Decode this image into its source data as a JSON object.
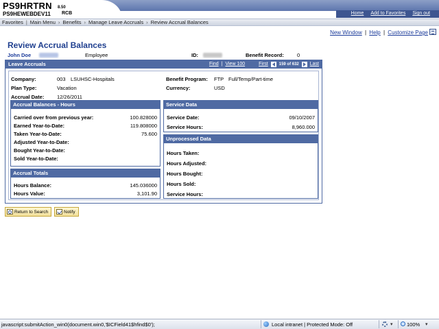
{
  "header": {
    "app_name": "PS9HRTRN",
    "version": "8.50",
    "database": "PS9HEWEBDEV11",
    "user": "RCB",
    "links": [
      "Home",
      "Add to Favorites",
      "Sign out"
    ]
  },
  "breadcrumb": [
    "Favorites",
    "Main Menu",
    "Benefits",
    "Manage Leave Accruals",
    "Review Accrual Balances"
  ],
  "page_links": {
    "new_window": "New Window",
    "help": "Help",
    "customize": "Customize Page",
    "sep": "|"
  },
  "page_title": "Review Accrual Balances",
  "employee": {
    "name": "John Doe",
    "type": "Employee",
    "id_label": "ID:",
    "benefit_record_label": "Benefit Record:",
    "benefit_record": "0"
  },
  "leave_accruals": {
    "title": "Leave Accruals",
    "nav": {
      "find": "Find",
      "view": "View 100",
      "first": "First",
      "count": "159 of 632",
      "last": "Last"
    },
    "company_label": "Company:",
    "company_code": "003",
    "company_name": "LSUHSC-Hospitals",
    "plan_type_label": "Plan Type:",
    "plan_type": "Vacation",
    "accrual_date_label": "Accrual Date:",
    "accrual_date": "12/26/2011",
    "benefit_program_label": "Benefit Program:",
    "benefit_program_code": "FTP",
    "benefit_program_name": "Full/Temp/Part-time",
    "currency_label": "Currency:",
    "currency": "USD"
  },
  "accrual_balances": {
    "title": "Accrual Balances - Hours",
    "rows": [
      {
        "label": "Carried over from previous year:",
        "value": "100.828000"
      },
      {
        "label": "Earned Year-to-Date:",
        "value": "119.808000"
      },
      {
        "label": "Taken Year-to-Date:",
        "value": "75.600"
      },
      {
        "label": "Adjusted Year-to-Date:",
        "value": ""
      },
      {
        "label": "Bought Year-to-Date:",
        "value": ""
      },
      {
        "label": "Sold Year-to-Date:",
        "value": ""
      }
    ]
  },
  "accrual_totals": {
    "title": "Accrual Totals",
    "rows": [
      {
        "label": "Hours Balance:",
        "value": "145.036000"
      },
      {
        "label": "Hours Value:",
        "value": "3,101.90"
      }
    ]
  },
  "service_data": {
    "title": "Service Data",
    "rows": [
      {
        "label": "Service Date:",
        "value": "09/10/2007"
      },
      {
        "label": "Service Hours:",
        "value": "8,960.000"
      }
    ]
  },
  "unprocessed_data": {
    "title": "Unprocessed Data",
    "rows": [
      {
        "label": "Hours Taken:",
        "value": ""
      },
      {
        "label": "Hours Adjusted:",
        "value": ""
      },
      {
        "label": "Hours Bought:",
        "value": ""
      },
      {
        "label": "Hours Sold:",
        "value": ""
      },
      {
        "label": "Service Hours:",
        "value": ""
      }
    ]
  },
  "buttons": {
    "return": "Return to Search",
    "notify": "Notify"
  },
  "status_bar": {
    "text": "javascript:submitAction_win0(document.win0,'$ICField41$hfind$0');",
    "zone": "Local intranet | Protected Mode: Off",
    "zoom": "100%"
  }
}
